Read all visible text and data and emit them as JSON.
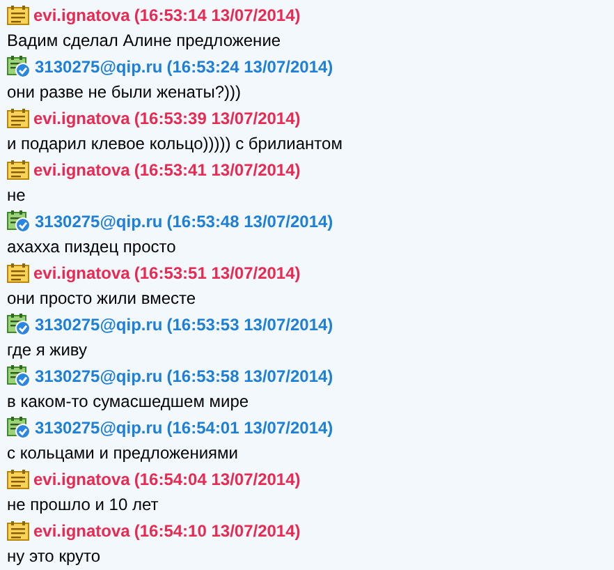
{
  "messages": [
    {
      "kind": "contact",
      "sender": "evi.ignatova",
      "time": "(16:53:14 13/07/2014)",
      "text": "Вадим сделал Алине предложение"
    },
    {
      "kind": "self",
      "sender": "3130275@qip.ru",
      "time": "(16:53:24 13/07/2014)",
      "text": "они разве не были женаты?)))"
    },
    {
      "kind": "contact",
      "sender": "evi.ignatova",
      "time": "(16:53:39 13/07/2014)",
      "text": "и подарил клевое кольцо))))) с брилиантом"
    },
    {
      "kind": "contact",
      "sender": "evi.ignatova",
      "time": "(16:53:41 13/07/2014)",
      "text": "не"
    },
    {
      "kind": "self",
      "sender": "3130275@qip.ru",
      "time": "(16:53:48 13/07/2014)",
      "text": "ахахха пиздец просто"
    },
    {
      "kind": "contact",
      "sender": "evi.ignatova",
      "time": "(16:53:51 13/07/2014)",
      "text": "они просто жили вместе"
    },
    {
      "kind": "self",
      "sender": "3130275@qip.ru",
      "time": "(16:53:53 13/07/2014)",
      "text": "где я живу"
    },
    {
      "kind": "self",
      "sender": "3130275@qip.ru",
      "time": "(16:53:58 13/07/2014)",
      "text": "в каком-то сумасшедшем мире"
    },
    {
      "kind": "self",
      "sender": "3130275@qip.ru",
      "time": "(16:54:01 13/07/2014)",
      "text": "с кольцами и предложениями"
    },
    {
      "kind": "contact",
      "sender": "evi.ignatova",
      "time": "(16:54:04 13/07/2014)",
      "text": "не прошло и 10 лет"
    },
    {
      "kind": "contact",
      "sender": "evi.ignatova",
      "time": "(16:54:10 13/07/2014)",
      "text": "ну это круто"
    }
  ]
}
